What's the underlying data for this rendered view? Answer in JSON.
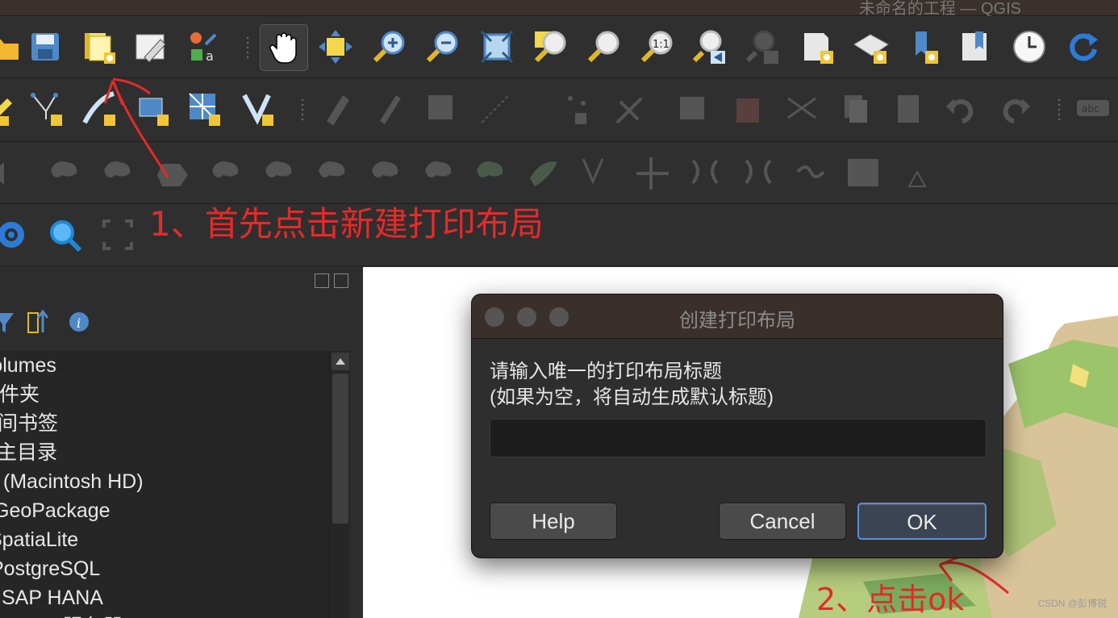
{
  "window": {
    "title": "未命名的工程 — QGIS"
  },
  "toolbar1": {
    "icons": [
      "open-project-icon",
      "save-project-icon",
      "new-print-layout-icon",
      "style-manager-icon",
      "new-layer-icon",
      "pan-icon",
      "pan-to-selection-icon",
      "zoom-in-icon",
      "zoom-out-icon",
      "zoom-full-icon",
      "zoom-to-selection-icon",
      "zoom-to-layer-icon",
      "zoom-native-icon",
      "zoom-last-icon",
      "zoom-next-icon",
      "new-bookmark-icon",
      "new-3d-map-icon",
      "show-bookmarks-icon",
      "new-map-view-icon",
      "temporal-controller-icon",
      "refresh-icon"
    ]
  },
  "toolbar3": {
    "icon_count": 18
  },
  "toolbar4": {
    "icons": [
      "settings-gear-icon",
      "search-icon",
      "select-frame-icon"
    ]
  },
  "browser_panel": {
    "toolbar_icons": [
      "filter-icon",
      "collapse-all-icon",
      "info-icon"
    ],
    "items": [
      "Volumes",
      "文件夹",
      "空间书签",
      "项目主目录",
      "/ (Macintosh HD)",
      "GeoPackage",
      "SpatiaLite",
      "PostgreSQL",
      "SAP HANA",
      "MSSQL服务器"
    ]
  },
  "annotations": {
    "step1": "1、首先点击新建打印布局",
    "step2": "2、点击ok",
    "watermark": "CSDN @彭博锐"
  },
  "dialog": {
    "title": "创建打印布局",
    "message": "请输入唯一的打印布局标题\n(如果为空，将自动生成默认标题)",
    "input_value": "",
    "buttons": {
      "help": "Help",
      "cancel": "Cancel",
      "ok": "OK"
    }
  },
  "colors": {
    "annotation": "#e52a2a",
    "ok_border": "#5b8fd6",
    "dialog_bg": "#2e2e2e",
    "titlebar_bg": "#3a2f2b"
  }
}
